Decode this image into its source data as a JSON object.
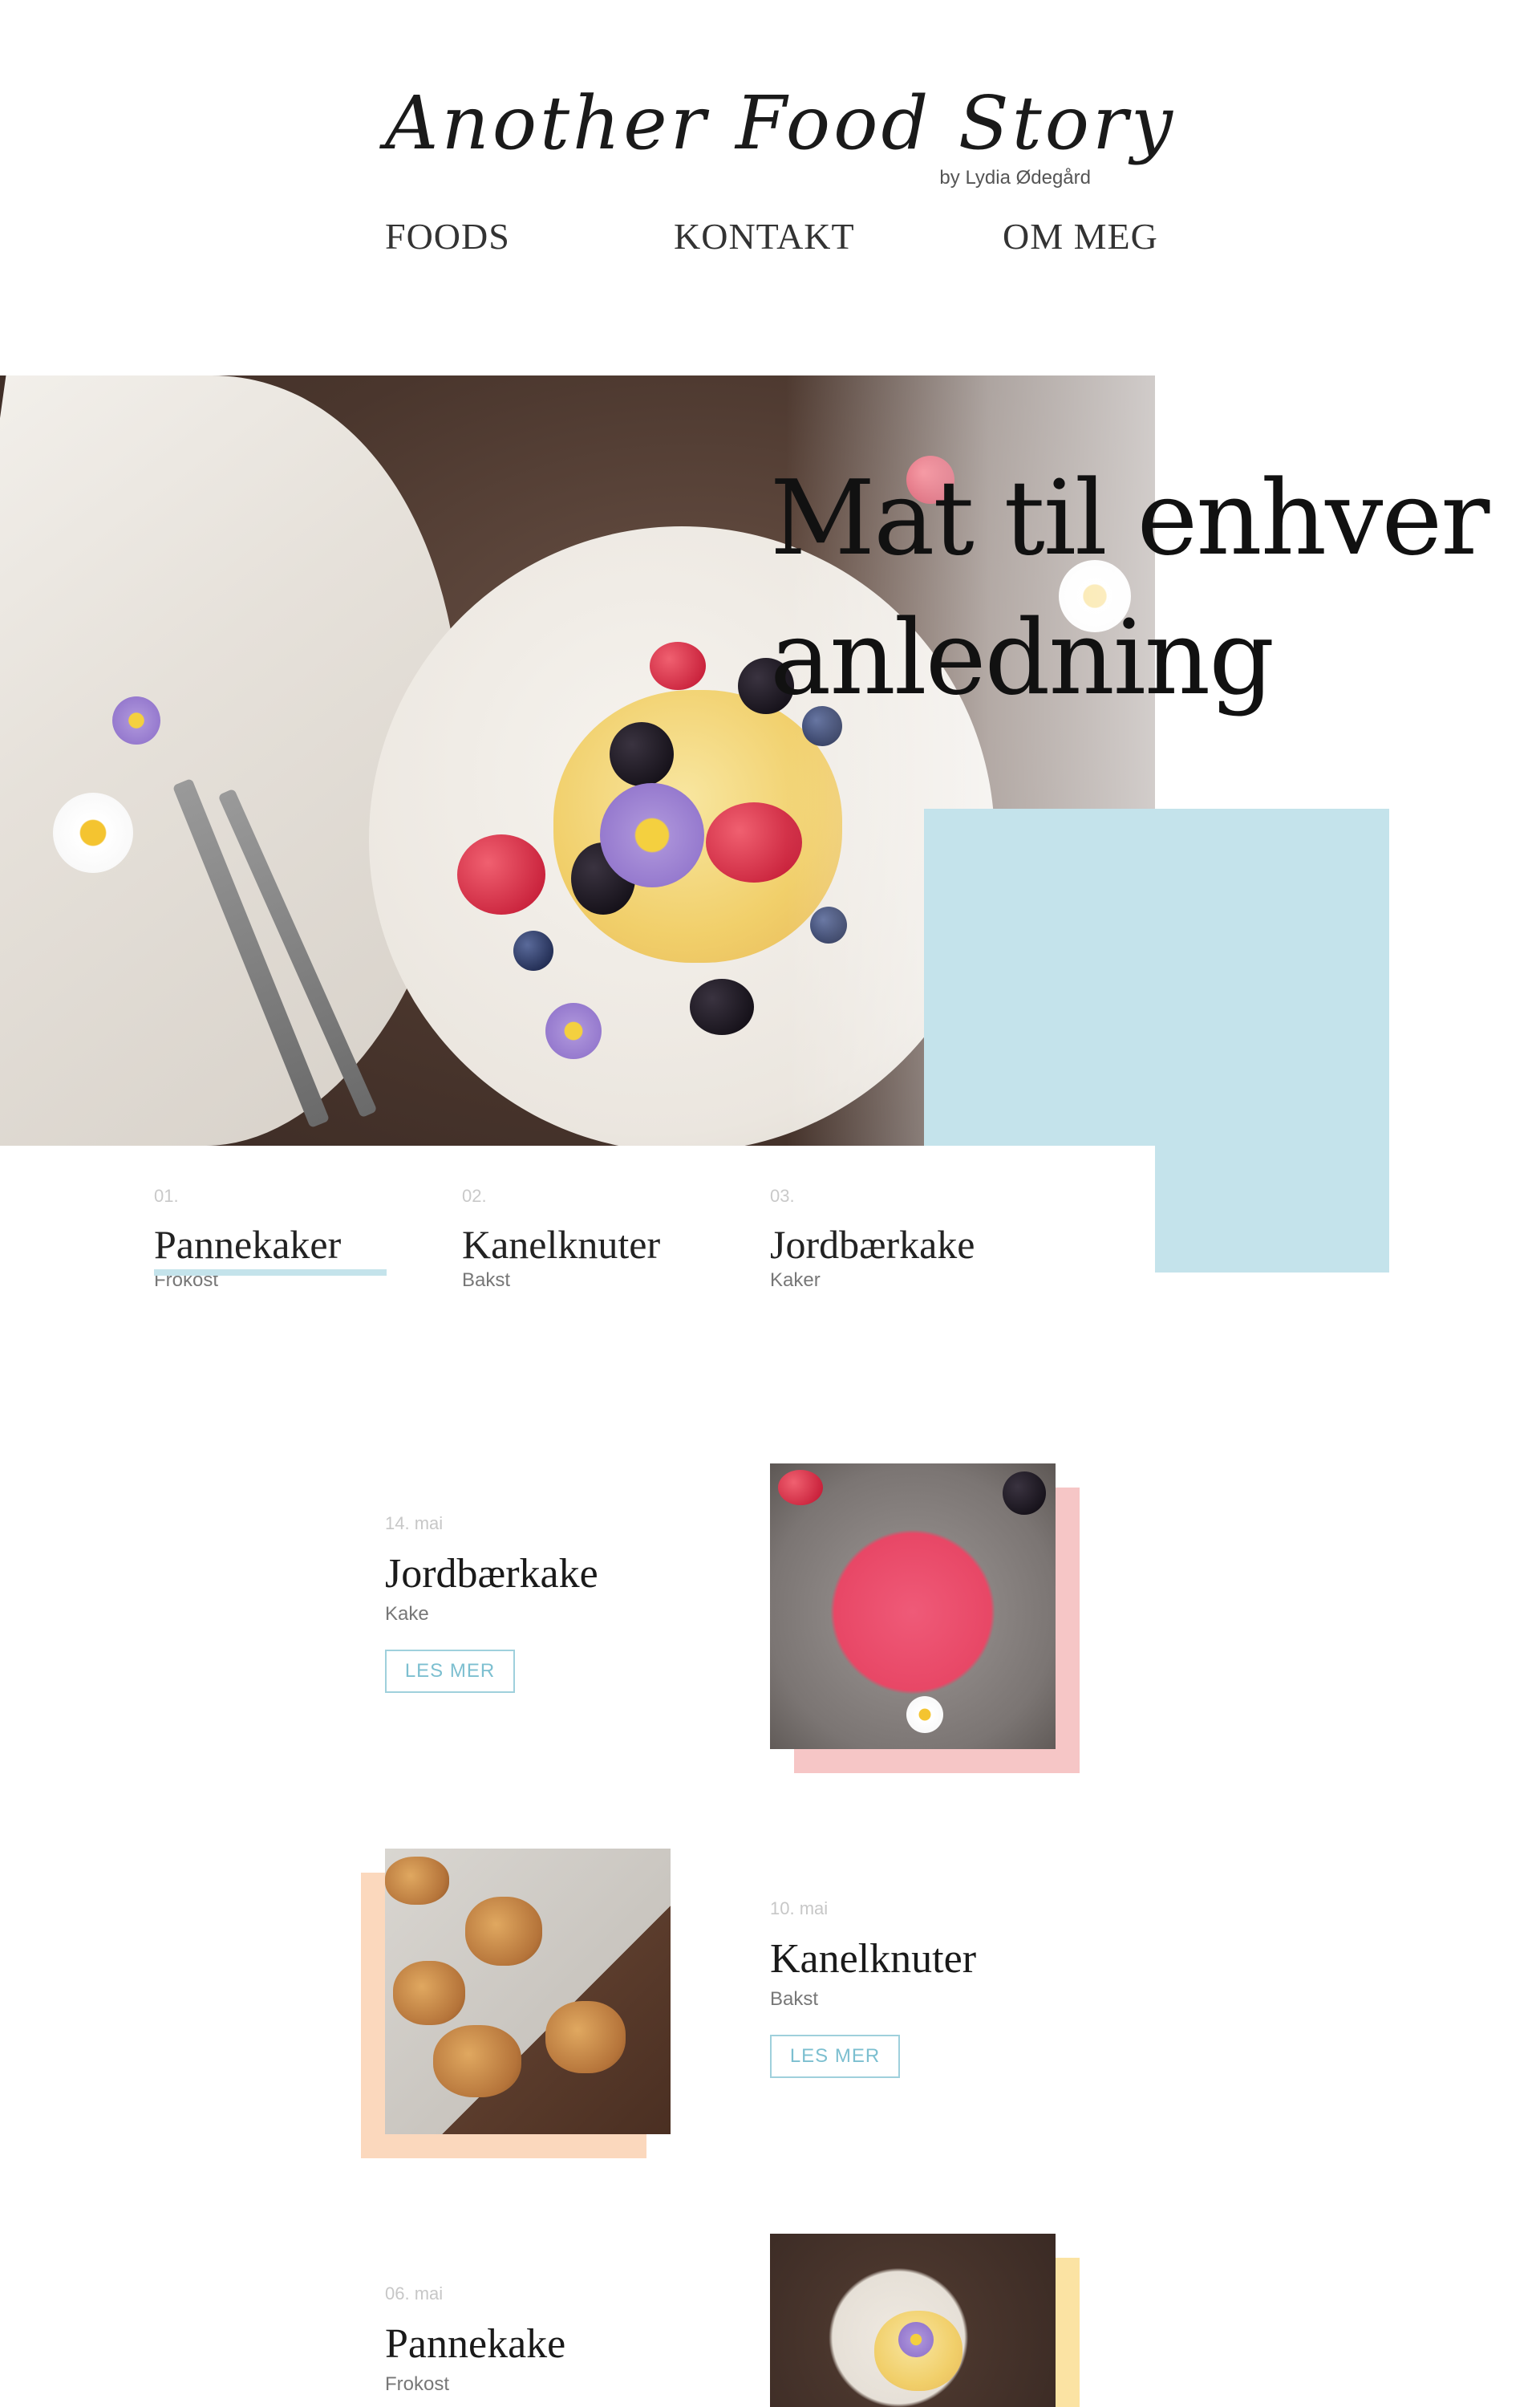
{
  "header": {
    "logo": "Another Food Story",
    "byline": "by Lydia Ødegård",
    "nav": [
      "FOODS",
      "KONTAKT",
      "OM MEG"
    ]
  },
  "hero": {
    "title_line1": "Mat til enhver",
    "title_line2": "anledning"
  },
  "featured": [
    {
      "num": "01.",
      "name": "Pannekaker",
      "category": "Frokost",
      "active": true
    },
    {
      "num": "02.",
      "name": "Kanelknuter",
      "category": "Bakst",
      "active": false
    },
    {
      "num": "03.",
      "name": "Jordbærkake",
      "category": "Kaker",
      "active": false
    }
  ],
  "posts": [
    {
      "date": "14. mai",
      "title": "Jordbærkake",
      "category": "Kake",
      "button": "LES MER"
    },
    {
      "date": "10. mai",
      "title": "Kanelknuter",
      "category": "Bakst",
      "button": "LES MER"
    },
    {
      "date": "06. mai",
      "title": "Pannekake",
      "category": "Frokost"
    }
  ],
  "colors": {
    "accent_blue": "#c4e3eb",
    "accent_pink": "#f6c6c6",
    "accent_peach": "#fbd8bd",
    "accent_yellow": "#fbe3a3",
    "button_text": "#7cbfd0"
  }
}
